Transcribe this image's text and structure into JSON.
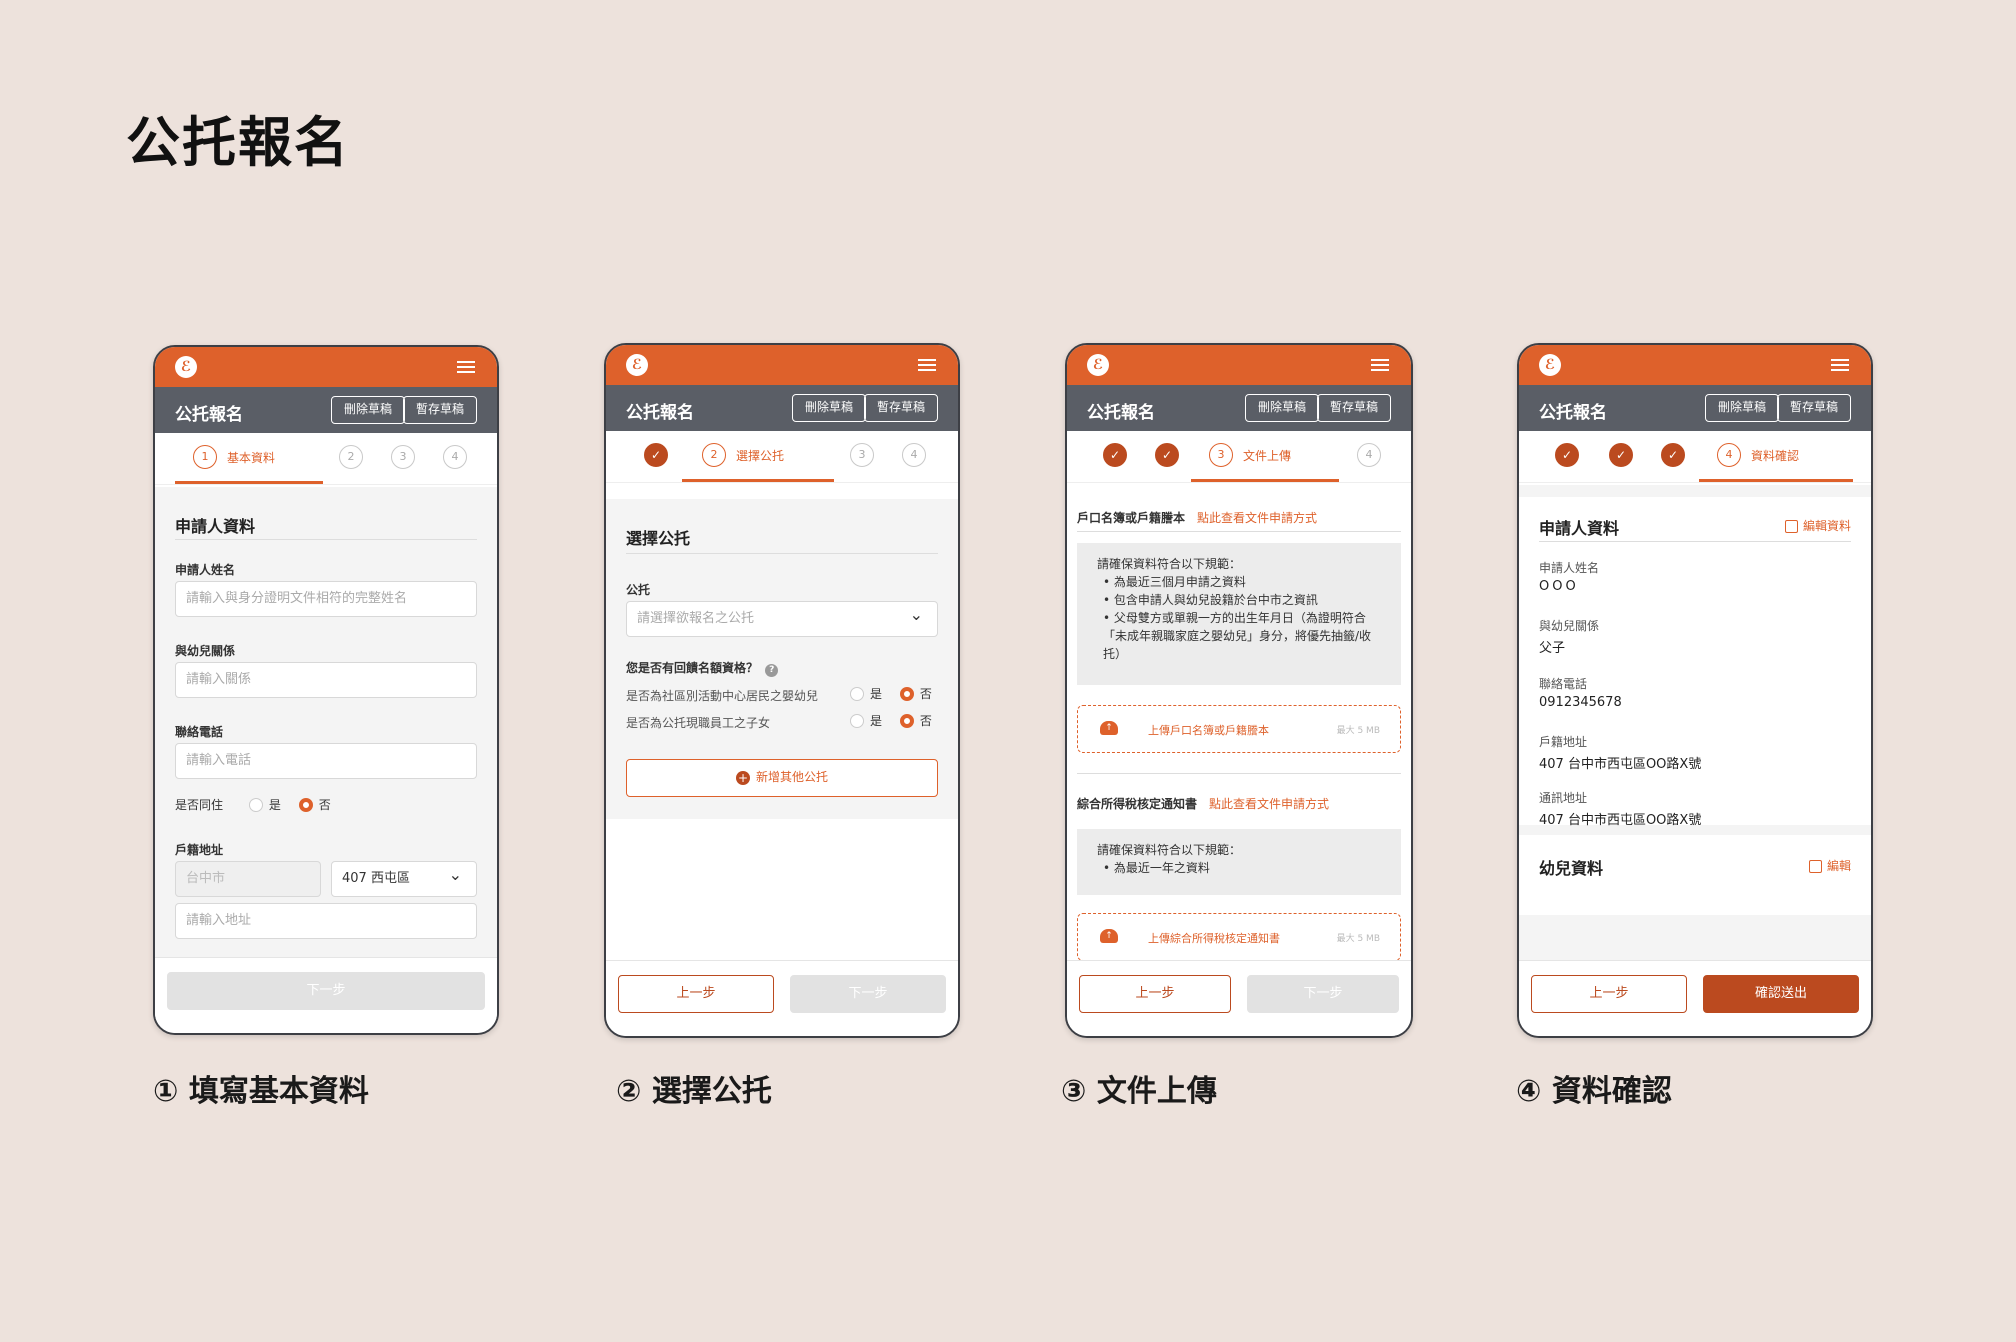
{
  "page_title": "公托報名",
  "common": {
    "app_title": "公托報名",
    "delete_draft": "刪除草稿",
    "save_draft": "暫存草稿",
    "logo_glyph": "ℰ",
    "step_nums": [
      "1",
      "2",
      "3",
      "4"
    ],
    "check": "✓",
    "prev": "上一步",
    "next": "下一步",
    "dropdown": "⌄"
  },
  "screen1": {
    "caption": "① 填寫基本資料",
    "step_label": "基本資料",
    "section": "申請人資料",
    "name_label": "申請人姓名",
    "name_placeholder": "請輸入與身分證明文件相符的完整姓名",
    "relation_label": "與幼兒關係",
    "relation_placeholder": "請輸入關係",
    "phone_label": "聯絡電話",
    "phone_placeholder": "請輸入電話",
    "cohabit_label": "是否同住",
    "yes": "是",
    "no": "否",
    "address_label": "戶籍地址",
    "city": "台中市",
    "district": "407 西屯區",
    "address_placeholder": "請輸入地址"
  },
  "screen2": {
    "caption": "② 選擇公托",
    "step_label": "選擇公托",
    "section": "選擇公托",
    "daycare_label": "公托",
    "daycare_placeholder": "請選擇欲報名之公托",
    "priority_label": "您是否有回饋名額資格？",
    "q1": "是否為社區別活動中心居民之嬰幼兒",
    "q2": "是否為公托現職員工之子女",
    "yes": "是",
    "no": "否",
    "add_btn": "新增其他公托",
    "help": "?"
  },
  "screen3": {
    "caption": "③ 文件上傳",
    "step_label": "文件上傳",
    "doc1_title": "戶口名簿或戶籍謄本",
    "doc1_link": "點此查看文件申請方式",
    "doc1_note_title": "請確保資料符合以下規範：",
    "doc1_rules": [
      "為最近三個月申請之資料",
      "包含申請人與幼兒設籍於台中市之資訊",
      "父母雙方或單親一方的出生年月日（為證明符合「未成年親職家庭之嬰幼兒」身分，將優先抽籤/收托）"
    ],
    "doc1_upload": "上傳戶口名簿或戶籍謄本",
    "max_size": "最大 5 MB",
    "doc2_title": "綜合所得稅核定通知書",
    "doc2_link": "點此查看文件申請方式",
    "doc2_note_title": "請確保資料符合以下規範：",
    "doc2_rules": [
      "為最近一年之資料"
    ],
    "doc2_upload": "上傳綜合所得稅核定通知書",
    "upload_glyph": "↑"
  },
  "screen4": {
    "caption": "④ 資料確認",
    "step_label": "資料確認",
    "section1": "申請人資料",
    "edit1": "編輯資料",
    "fields": [
      {
        "label": "申請人姓名",
        "value": "OOO"
      },
      {
        "label": "與幼兒關係",
        "value": "父子"
      },
      {
        "label": "聯絡電話",
        "value": "0912345678"
      },
      {
        "label": "戶籍地址",
        "value": "407 台中市西屯區OO路X號"
      },
      {
        "label": "通訊地址",
        "value": "407 台中市西屯區OO路X號"
      }
    ],
    "section2": "幼兒資料",
    "edit2": "編輯",
    "confirm": "確認送出"
  },
  "colors": {
    "accent": "#de612b",
    "accent_dark": "#bb4a1f",
    "titlebar": "#5a5e66",
    "background": "#ede2dc"
  }
}
